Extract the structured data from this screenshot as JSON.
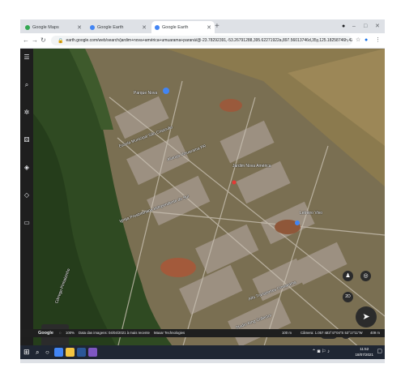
{
  "browser": {
    "tabs": [
      {
        "title": "Google Maps",
        "icon": "google-maps-icon",
        "active": false
      },
      {
        "title": "Google Earth",
        "icon": "google-earth-icon",
        "active": false
      },
      {
        "title": "Google Earth",
        "icon": "google-earth-icon",
        "active": true
      }
    ],
    "url": "earth.google.com/web/search/jardim+nova+américa+umuarama+paraná/@-23.78292391,-53.26791288,395.62271922a,897.56013746d,35y,125.18258746h,42.50444061t,0r/data...",
    "window_controls": [
      "–",
      "□",
      "✕"
    ]
  },
  "map": {
    "labels": [
      {
        "text": "Jardim Nova América",
        "name": "label-jardim-nova-america"
      },
      {
        "text": "Aliança Umuarama PR",
        "name": "label-alianca-umuarama"
      },
      {
        "text": "Igreja Presbiteriana Independente do Sul",
        "name": "label-igreja-presbiteriana"
      },
      {
        "text": "Escola Municipal São Cristovão",
        "name": "label-escola-municipal"
      },
      {
        "text": "Alfa Transportes Umuarama",
        "name": "label-alfa-transportes"
      },
      {
        "text": "Studio King Collector",
        "name": "label-studio-king"
      },
      {
        "text": "Letreiro Vivo",
        "name": "label-letreiro-vivo"
      },
      {
        "text": "Parque Nova",
        "name": "label-parque-nova"
      },
      {
        "text": "Córrego Pinhalzinho",
        "name": "label-corrego"
      }
    ],
    "view_mode": "2D"
  },
  "status": {
    "brand": "Google",
    "zoom": "100%",
    "imagery": "Data das imagens: 04/04/2021 à mais recente",
    "attribution": "Maxar Technologies",
    "scale": "100 m",
    "camera": "Câmera: 1.057 m",
    "coords": "23°47'04\"S 53°17'11\"W",
    "elevation": "409 m"
  },
  "taskbar": {
    "time": "11:52",
    "date": "18/07/2021"
  }
}
